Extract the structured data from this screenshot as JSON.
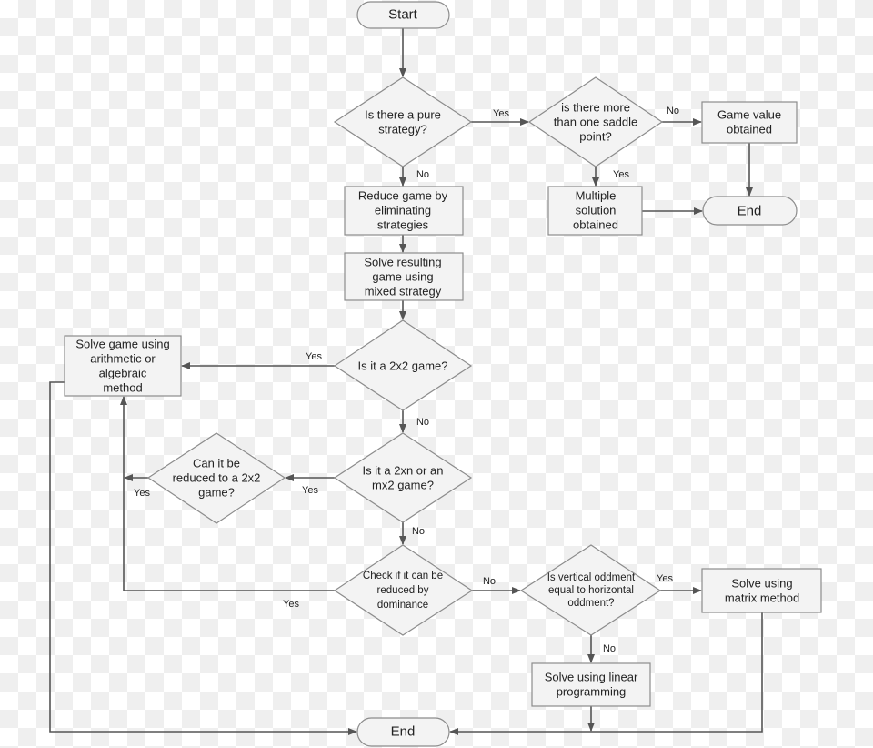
{
  "nodes": {
    "start": [
      "Start"
    ],
    "pure": [
      "Is there a pure",
      "strategy?"
    ],
    "saddle": [
      "is there more",
      "than one saddle",
      "point?"
    ],
    "game_value": [
      "Game value",
      "obtained"
    ],
    "end_top": [
      "End"
    ],
    "multiple": [
      "Multiple",
      "solution",
      "obtained"
    ],
    "reduce": [
      "Reduce game by",
      "eliminating",
      "strategies"
    ],
    "mixed": [
      "Solve resulting",
      "game using",
      "mixed strategy"
    ],
    "is2x2": [
      "Is it a 2x2 game?"
    ],
    "arith": [
      "Solve game using",
      "arithmetic or",
      "algebraic",
      "method"
    ],
    "is2xn": [
      "Is it a 2xn or an",
      "mx2 game?"
    ],
    "canreduce": [
      "Can it be",
      "reduced to a 2x2",
      "game?"
    ],
    "dominance": [
      "Check if it can be",
      "reduced by",
      "dominance"
    ],
    "oddment": [
      "Is vertical oddment",
      "equal to horizontal",
      "oddment?"
    ],
    "matrix": [
      "Solve using",
      "matrix method"
    ],
    "lp": [
      "Solve using linear",
      "programming"
    ],
    "end_bottom": [
      "End"
    ]
  },
  "edge_labels": {
    "pure_yes": "Yes",
    "saddle_no": "No",
    "saddle_yes": "Yes",
    "pure_no": "No",
    "is2x2_yes": "Yes",
    "is2x2_no": "No",
    "is2xn_yes": "Yes",
    "canreduce_yes": "Yes",
    "is2xn_no": "No",
    "dominance_yes": "Yes",
    "dominance_no": "No",
    "oddment_yes": "Yes",
    "oddment_no": "No"
  },
  "colors": {
    "shape_fill": "#f3f3f3",
    "shape_stroke": "#8c8c8c",
    "connector": "#555555"
  }
}
